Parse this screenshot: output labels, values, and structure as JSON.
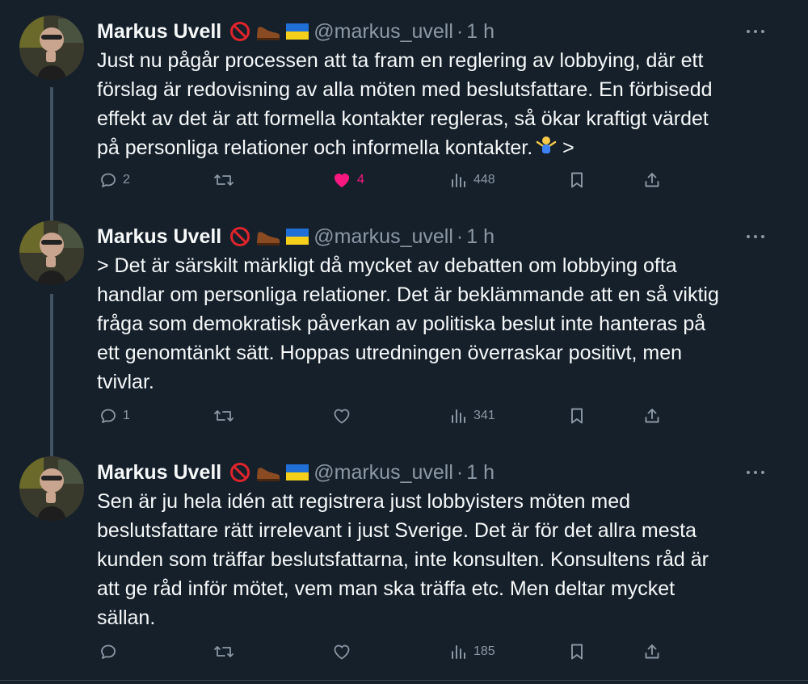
{
  "tweets": [
    {
      "author": {
        "name": "Markus Uvell",
        "handle": "@markus_uvell",
        "separator": "·",
        "time": "1 h"
      },
      "lines": [
        "Just nu pågår processen att ta fram en reglering av lobbying, där ett",
        "förslag är redovisning av alla möten med beslutsfattare. En förbisedd",
        "effekt av det är att formella kontakter regleras, så ökar kraftigt värdet",
        "på personliga relationer och informella kontakter."
      ],
      "line_suffix": ">",
      "reply_count": "2",
      "retweet_count": "",
      "like_count": "4",
      "liked": true,
      "views": "448"
    },
    {
      "author": {
        "name": "Markus Uvell",
        "handle": "@markus_uvell",
        "separator": "·",
        "time": "1 h"
      },
      "lines": [
        "> Det är särskilt märkligt då mycket av debatten om lobbying ofta",
        "handlar om personliga relationer. Det är beklämmande att en så viktig",
        "fråga som demokratisk påverkan av politiska beslut inte hanteras på",
        "ett genomtänkt sätt. Hoppas utredningen överraskar positivt, men",
        "tvivlar."
      ],
      "reply_count": "1",
      "retweet_count": "",
      "like_count": "",
      "liked": false,
      "views": "341"
    },
    {
      "author": {
        "name": "Markus Uvell",
        "handle": "@markus_uvell",
        "separator": "·",
        "time": "1 h"
      },
      "lines": [
        "Sen är ju hela idén att registrera just lobbyisters möten med",
        "beslutsfattare rätt irrelevant i just Sverige. Det är för det allra mesta",
        "kunden som träffar beslutsfattarna, inte konsulten. Konsultens råd är",
        "att ge råd inför mötet, vem man ska träffa etc. Men deltar mycket",
        "sällan."
      ],
      "reply_count": "",
      "retweet_count": "",
      "like_count": "",
      "liked": false,
      "views": "185"
    }
  ],
  "badge_icons": [
    "prohibited-icon",
    "shoe-icon",
    "ukraine-flag-icon"
  ],
  "colors": {
    "background": "#15202b",
    "text": "#f7f9f9",
    "secondary": "#8b98a5",
    "like": "#f91880",
    "thread_line": "#425364"
  }
}
